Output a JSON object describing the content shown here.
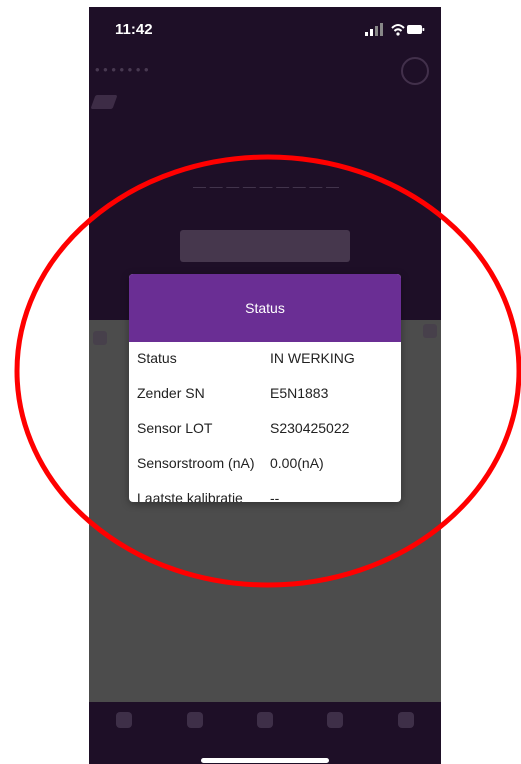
{
  "status_bar": {
    "time": "11:42",
    "icons": [
      "signal-icon",
      "wifi-icon",
      "battery-icon"
    ]
  },
  "dialog": {
    "title": "Status",
    "rows": [
      {
        "label": "Status",
        "value": "IN WERKING"
      },
      {
        "label": "Zender SN",
        "value": "E5N1883"
      },
      {
        "label": "Sensor LOT",
        "value": "S230425022"
      },
      {
        "label": "Sensorstroom (nA)",
        "value": "0.00(nA)"
      },
      {
        "label": "Laatste kalibratie",
        "value": "--"
      }
    ]
  },
  "colors": {
    "dialog_header": "#6a2e94",
    "app_background": "#1e0f27",
    "overlay_gray": "#4c4c4c",
    "annotation_red": "#ff0000"
  },
  "tabbar": {
    "icons": [
      "home-icon",
      "meter-icon",
      "document-icon",
      "calendar-icon",
      "settings-icon"
    ]
  }
}
